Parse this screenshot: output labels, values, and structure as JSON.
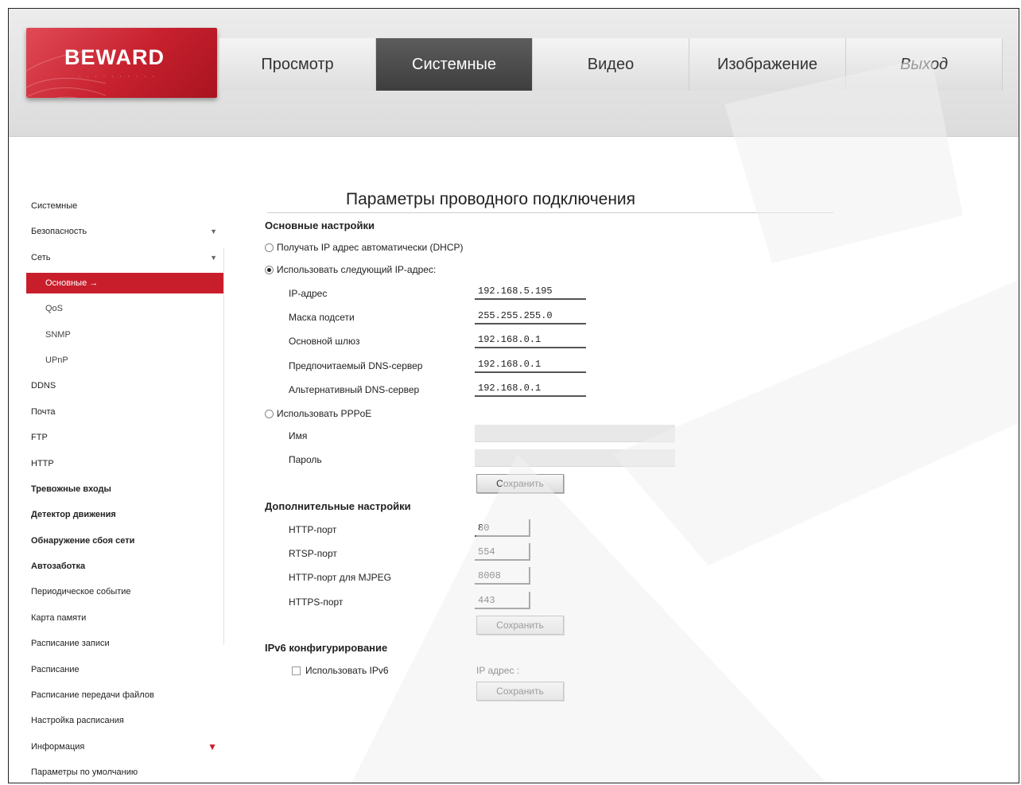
{
  "brand": {
    "name": "BEWARD",
    "tagline": "· · · · · · · · · ·"
  },
  "nav": [
    {
      "label": "Просмотр",
      "active": false
    },
    {
      "label": "Системные",
      "active": true
    },
    {
      "label": "Видео",
      "active": false
    },
    {
      "label": "Изображение",
      "active": false
    },
    {
      "label": "Выход",
      "active": false
    }
  ],
  "sidebar": {
    "items": [
      {
        "label": "Системные"
      },
      {
        "label": "Безопасность"
      },
      {
        "label": "Сеть"
      },
      {
        "label": "Основные"
      },
      {
        "label": "QoS"
      },
      {
        "label": "SNMP"
      },
      {
        "label": "UPnP"
      },
      {
        "label": "DDNS"
      },
      {
        "label": "Почта"
      },
      {
        "label": "FTP"
      },
      {
        "label": "HTTP"
      },
      {
        "label": "Тревожные входы"
      },
      {
        "label": "Детектор движения"
      },
      {
        "label": "Обнаружение сбоя сети"
      },
      {
        "label": "Автозаботка"
      },
      {
        "label": "Периодическое событие"
      },
      {
        "label": "Карта памяти"
      },
      {
        "label": "Расписание записи"
      },
      {
        "label": "Расписание"
      },
      {
        "label": "Расписание передачи файлов"
      },
      {
        "label": "Настройка расписания"
      },
      {
        "label": "Информация"
      },
      {
        "label": "Параметры по умолчанию"
      }
    ]
  },
  "page": {
    "title": "Параметры проводного подключения",
    "basic": {
      "heading": "Основные настройки",
      "dhcp_label": "Получать IP адрес автоматически (DHCP)",
      "static_label": "Использовать следующий IP-адрес:",
      "selected": "static",
      "fields": [
        {
          "label": "IP-адрес",
          "value": "192.168.5.195"
        },
        {
          "label": "Маска подсети",
          "value": "255.255.255.0"
        },
        {
          "label": "Основной шлюз",
          "value": "192.168.0.1"
        },
        {
          "label": "Предпочитаемый DNS-сервер",
          "value": "192.168.0.1"
        },
        {
          "label": "Альтернативный DNS-сервер",
          "value": "192.168.0.1"
        }
      ],
      "pppoe_label": "Использовать PPPoE",
      "pppoe_fields": [
        {
          "label": "Имя",
          "value": ""
        },
        {
          "label": "Пароль",
          "value": ""
        }
      ],
      "save_label": "Сохранить"
    },
    "advanced": {
      "heading": "Дополнительные настройки",
      "fields": [
        {
          "label": "HTTP-порт",
          "value": "80"
        },
        {
          "label": "RTSP-порт",
          "value": "554"
        },
        {
          "label": "HTTP-порт для MJPEG",
          "value": "8008"
        },
        {
          "label": "HTTPS-порт",
          "value": "443"
        }
      ],
      "save_label": "Сохранить"
    },
    "ipv6": {
      "heading": "IPv6 конфигурирование",
      "use_label": "Использовать IPv6",
      "ip_label": "IP адрес :",
      "save_label": "Сохранить"
    }
  },
  "colors": {
    "accent": "#c81e2c",
    "active_tab": "#4a4a4a",
    "header_bg": "#e0e0e0"
  }
}
